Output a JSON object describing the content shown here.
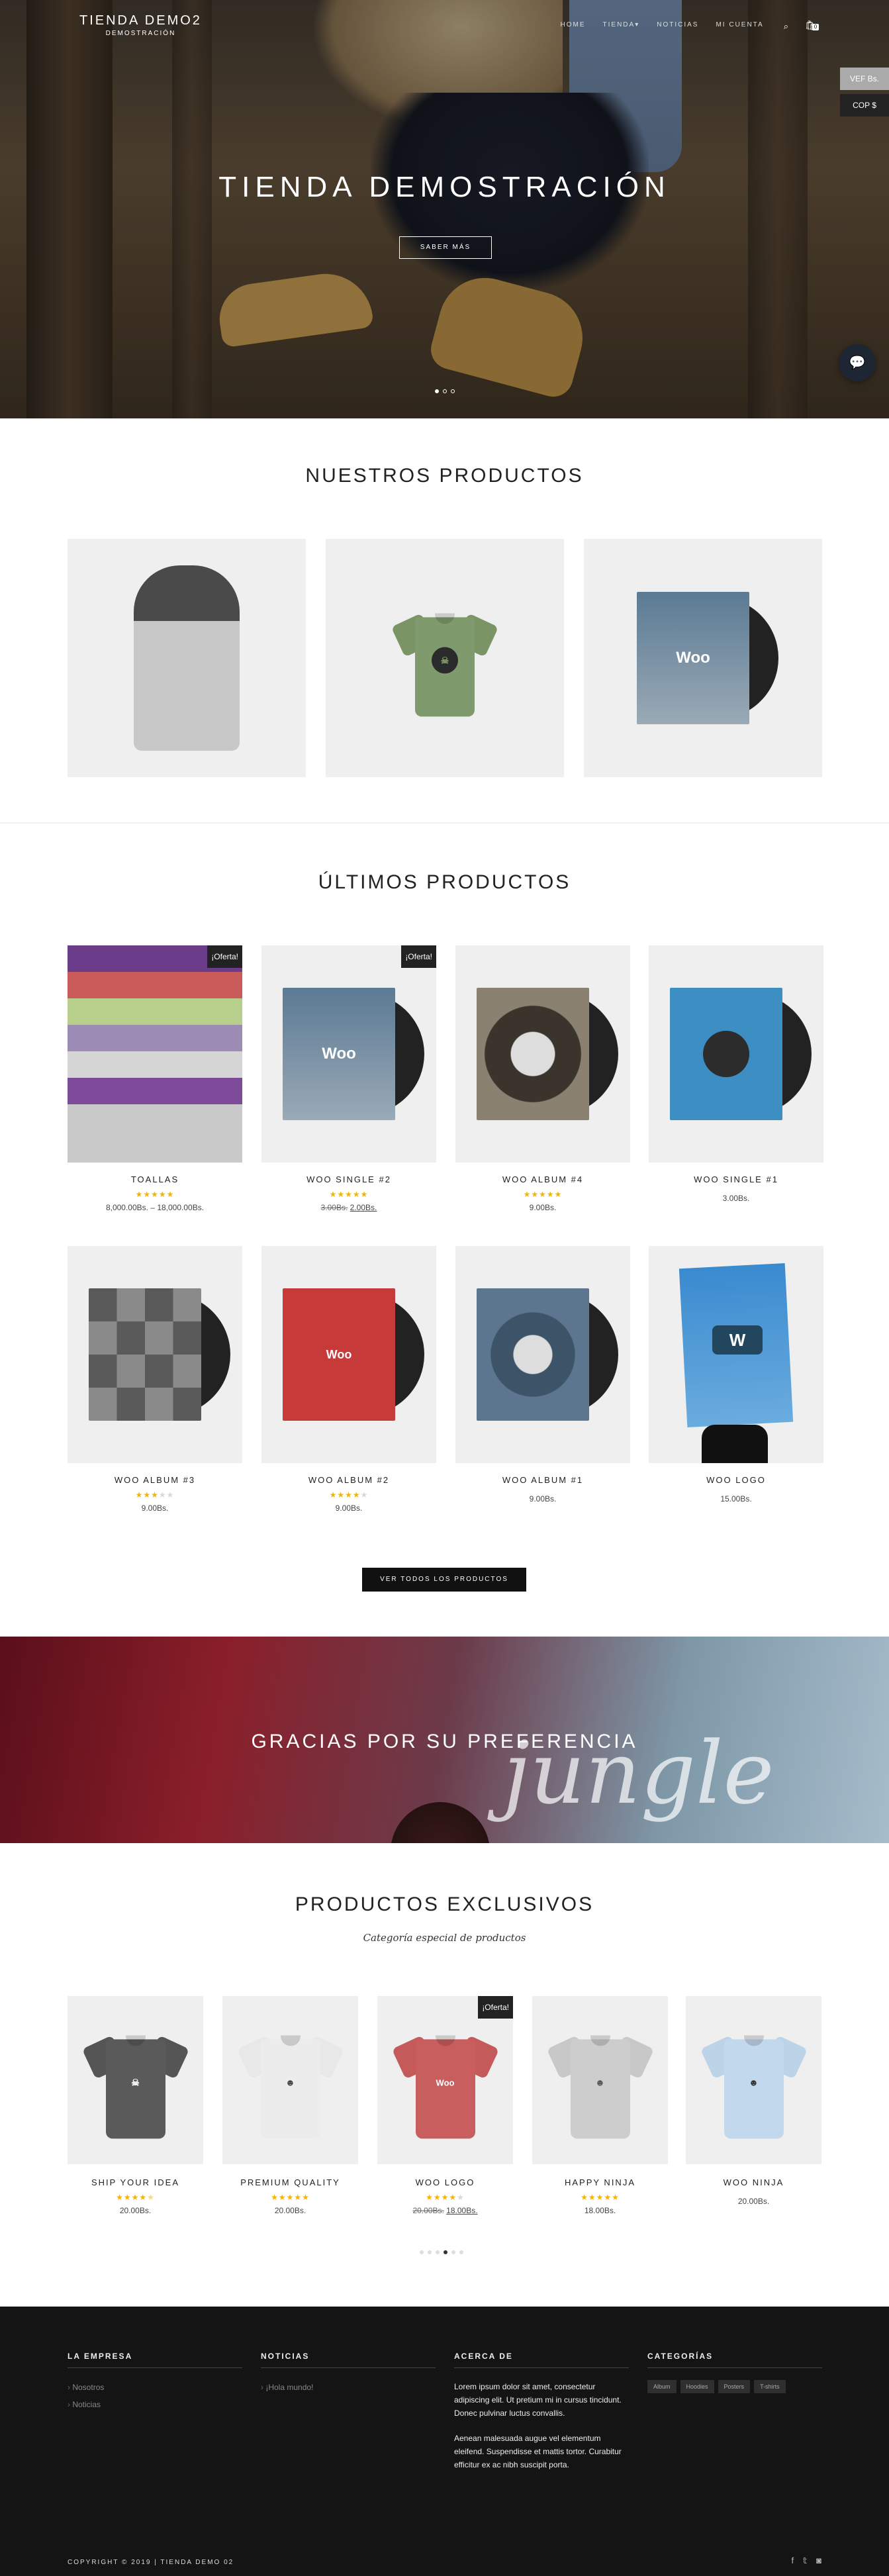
{
  "header": {
    "logo_main": "TIENDA DEMO2",
    "logo_sub": "DEMOSTRACIÓN",
    "menu": [
      "HOME",
      "TIENDA",
      "NOTICIAS",
      "MI CUENTA"
    ],
    "tienda_caret": "▾",
    "cart_count": "0"
  },
  "currency": {
    "ves": "VEF Bs.",
    "cop": "COP $"
  },
  "hero": {
    "title": "TIENDA DEMOSTRACIÓN",
    "button": "SABER MÁS"
  },
  "featured": {
    "title": "NUESTROS PRODUCTOS"
  },
  "latest": {
    "title": "ÚLTIMOS PRODUCTOS",
    "products": [
      {
        "name": "TOALLAS",
        "rating": 5,
        "price": "8,000.00Bs. – 18,000.00Bs.",
        "sale": "¡Oferta!"
      },
      {
        "name": "WOO SINGLE #2",
        "rating": 5,
        "old_price": "3.00Bs.",
        "price": "2.00Bs.",
        "sale": "¡Oferta!"
      },
      {
        "name": "WOO ALBUM #4",
        "rating": 5,
        "price": "9.00Bs."
      },
      {
        "name": "WOO SINGLE #1",
        "price": "3.00Bs."
      },
      {
        "name": "WOO ALBUM #3",
        "rating": 3,
        "price": "9.00Bs."
      },
      {
        "name": "WOO ALBUM #2",
        "rating": 4,
        "price": "9.00Bs."
      },
      {
        "name": "WOO ALBUM #1",
        "price": "9.00Bs."
      },
      {
        "name": "WOO LOGO",
        "price": "15.00Bs."
      }
    ],
    "view_all": "VER TODOS LOS PRODUCTOS"
  },
  "banner": {
    "title": "GRACIAS POR SU PREFERENCIA",
    "script": "jungle"
  },
  "exclusive": {
    "title": "PRODUCTOS EXCLUSIVOS",
    "subtitle": "Categoría especial de productos",
    "products": [
      {
        "name": "SHIP YOUR IDEA",
        "rating": 4.5,
        "price": "20.00Bs."
      },
      {
        "name": "PREMIUM QUALITY",
        "rating": 5,
        "price": "20.00Bs."
      },
      {
        "name": "WOO LOGO",
        "rating": 4,
        "old_price": "20.00Bs.",
        "price": "18.00Bs.",
        "sale": "¡Oferta!"
      },
      {
        "name": "HAPPY NINJA",
        "rating": 5,
        "price": "18.00Bs."
      },
      {
        "name": "WOO NINJA",
        "price": "20.00Bs."
      }
    ]
  },
  "footer": {
    "empresa": {
      "title": "LA EMPRESA",
      "links": [
        "Nosotros",
        "Noticias"
      ]
    },
    "noticias": {
      "title": "NOTICIAS",
      "links": [
        "¡Hola mundo!"
      ]
    },
    "acerca": {
      "title": "ACERCA DE",
      "p1": "Lorem ipsum dolor sit amet, consectetur adipiscing elit. Ut pretium mi in cursus tincidunt. Donec pulvinar luctus convallis.",
      "p2": "Aenean malesuada augue vel elementum eleifend. Suspendisse et mattis tortor. Curabitur efficitur ex ac nibh suscipit porta."
    },
    "categorias": {
      "title": "CATEGORÍAS",
      "tags": [
        "Album",
        "Hoodies",
        "Posters",
        "T-shirts"
      ]
    },
    "copyright": "COPYRIGHT © 2019 | TIENDA DEMO 02"
  },
  "colors": {
    "accent": "#f5b400",
    "dark": "#111111",
    "footer_bg": "#141414"
  },
  "icons": {
    "search": "search-icon",
    "cart": "cart-icon",
    "chat": "chat-icon",
    "social": [
      "facebook-icon",
      "twitter-icon",
      "instagram-icon"
    ]
  }
}
